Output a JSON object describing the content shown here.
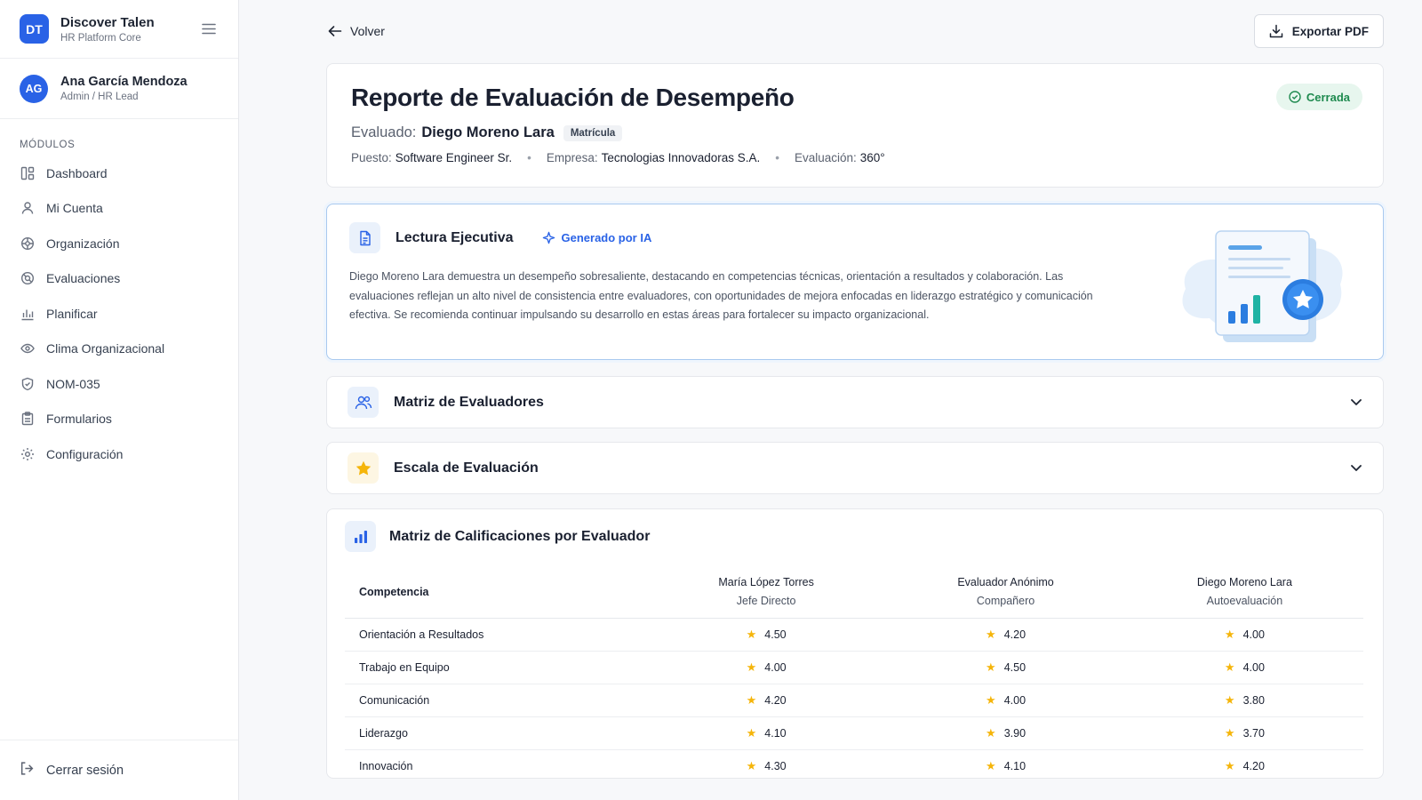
{
  "brand": {
    "logo": "DT",
    "name": "Discover Talen",
    "subtitle": "HR Platform Core"
  },
  "user": {
    "initials": "AG",
    "name": "Ana García Mendoza",
    "role": "Admin / HR Lead"
  },
  "sidebar": {
    "section_title": "MÓDULOS",
    "items": [
      {
        "label": "Dashboard",
        "icon": "dashboard-icon"
      },
      {
        "label": "Mi Cuenta",
        "icon": "user-icon"
      },
      {
        "label": "Organización",
        "icon": "organization-icon"
      },
      {
        "label": "Evaluaciones",
        "icon": "evaluations-icon"
      },
      {
        "label": "Planificar",
        "icon": "chart-icon"
      },
      {
        "label": "Clima Organizacional",
        "icon": "eye-icon"
      },
      {
        "label": "NOM-035",
        "icon": "shield-icon"
      },
      {
        "label": "Formularios",
        "icon": "clipboard-icon"
      },
      {
        "label": "Configuración",
        "icon": "gear-icon"
      }
    ],
    "logout": "Cerrar sesión"
  },
  "topbar": {
    "back": "Volver",
    "export": "Exportar PDF"
  },
  "report": {
    "title": "Reporte de Evaluación de Desempeño",
    "status": "Cerrada",
    "evaluated_label": "Evaluado:",
    "evaluated_name": "Diego Moreno Lara",
    "tag": "Matrícula",
    "position_label": "Puesto:",
    "position": "Software Engineer Sr.",
    "company_label": "Empresa:",
    "company": "Tecnologias Innovadoras S.A.",
    "evaluation_label": "Evaluación:",
    "evaluation": "360°"
  },
  "executive": {
    "title": "Lectura Ejecutiva",
    "ai_badge": "Generado por IA",
    "text": "Diego Moreno Lara demuestra un desempeño sobresaliente, destacando en competencias técnicas, orientación a resultados y colaboración. Las evaluaciones reflejan un alto nivel de consistencia entre evaluadores, con oportunidades de mejora enfocadas en liderazgo estratégico y comunicación efectiva. Se recomienda continuar impulsando su desarrollo en estas áreas para fortalecer su impacto organizacional."
  },
  "accordions": [
    {
      "title": "Matriz de Evaluadores"
    },
    {
      "title": "Escala de Evaluación"
    }
  ],
  "matrix": {
    "title": "Matriz de Calificaciones por Evaluador",
    "header_competence": "Competencia",
    "evaluators": [
      {
        "name": "María López Torres",
        "role": "Jefe Directo"
      },
      {
        "name": "Evaluador Anónimo",
        "role": "Compañero"
      },
      {
        "name": "Diego Moreno Lara",
        "role": "Autoevaluación"
      }
    ],
    "rows": [
      {
        "competence": "Orientación a Resultados",
        "scores": [
          "4.50",
          "4.20",
          "4.00"
        ]
      },
      {
        "competence": "Trabajo en Equipo",
        "scores": [
          "4.00",
          "4.50",
          "4.00"
        ]
      },
      {
        "competence": "Comunicación",
        "scores": [
          "4.20",
          "4.00",
          "3.80"
        ]
      },
      {
        "competence": "Liderazgo",
        "scores": [
          "4.10",
          "3.90",
          "3.70"
        ]
      },
      {
        "competence": "Innovación",
        "scores": [
          "4.30",
          "4.10",
          "4.20"
        ]
      }
    ]
  },
  "colors": {
    "accent": "#2962e6",
    "status_bg": "#e7f6ee",
    "status_text": "#1e8a4f",
    "star": "#f5b50a"
  }
}
